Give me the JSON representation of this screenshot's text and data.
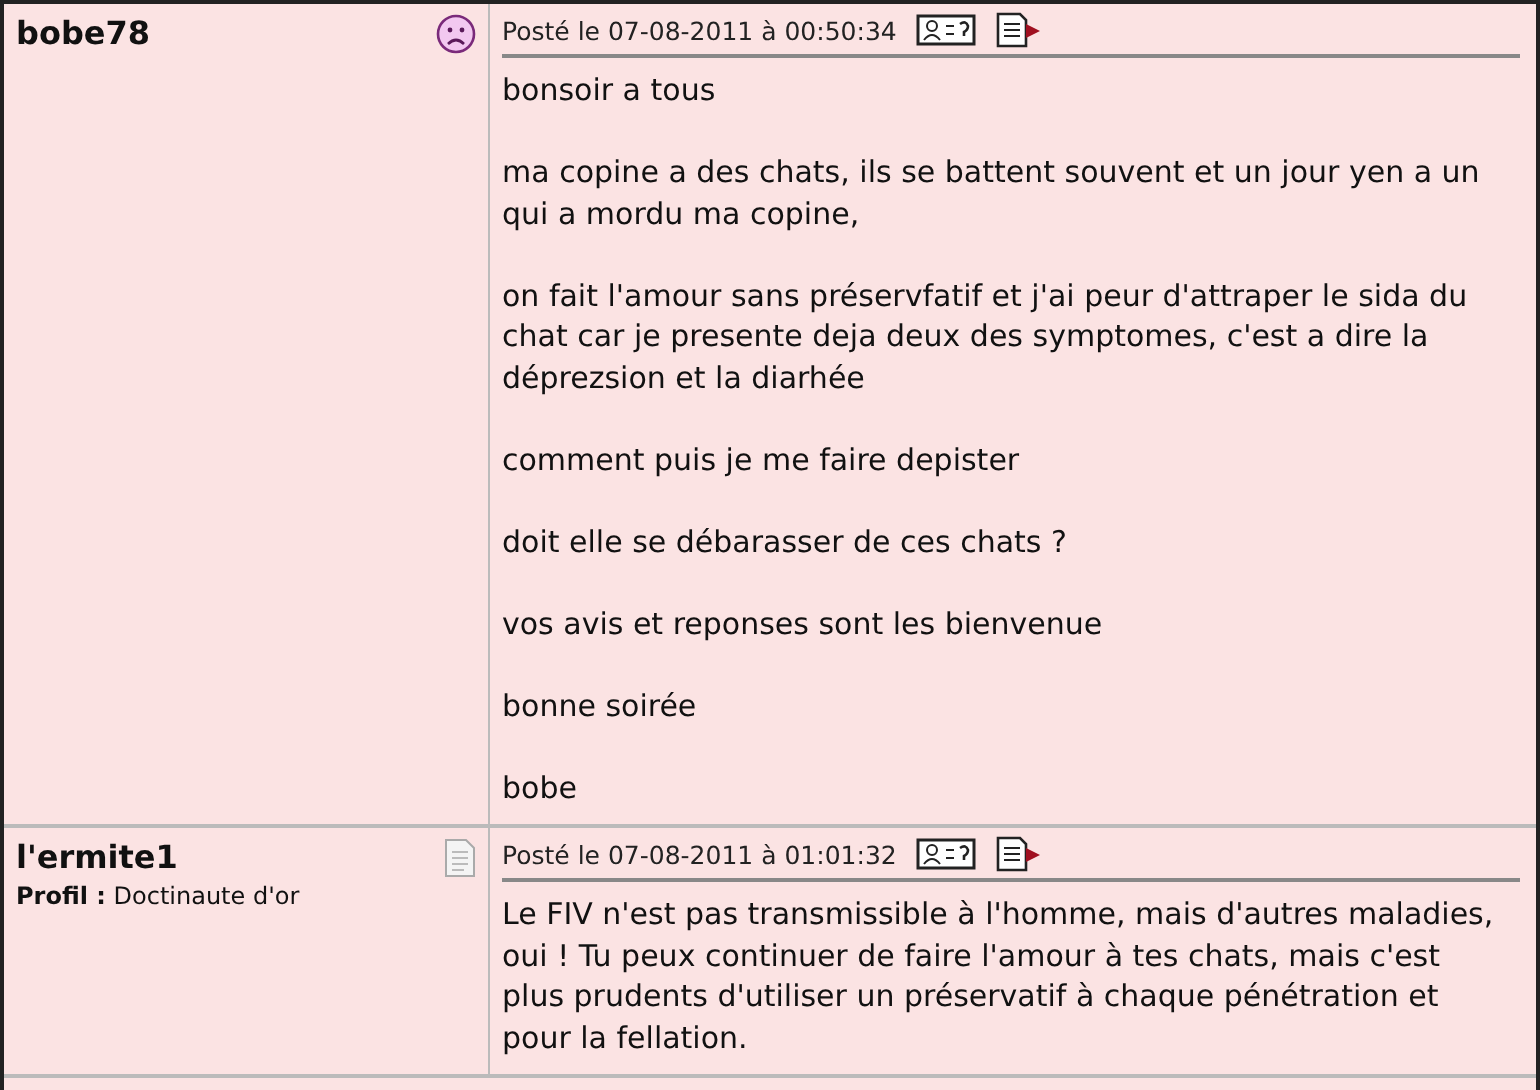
{
  "posts": [
    {
      "author": "bobe78",
      "kind": "sad",
      "date": "Posté le 07-08-2011 à 00:50:34",
      "paragraphs": [
        "bonsoir a tous",
        "ma copine a des chats, ils se battent souvent et un jour yen a un qui a mordu ma copine,",
        "on fait l'amour sans préservfatif et j'ai peur d'attraper le sida du chat car je presente deja deux des symptomes, c'est a dire la déprezsion et la diarhée",
        "comment puis je me faire depister",
        "doit elle se débarasser de ces chats ?",
        "vos avis et reponses sont les bienvenue",
        "bonne soirée",
        "bobe"
      ]
    },
    {
      "author": "l'ermite1",
      "profile": "**Profil :** Doctinaute d'or",
      "kind": "document",
      "date": "Posté le 07-08-2011 à 01:01:32",
      "paragraphs": [
        "Le FIV n'est pas transmissible à l'homme, mais d'autres maladies, oui ! Tu peux continuer de faire l'amour à tes chats, mais c'est plus prudents d'utiliser un préservatif à chaque pénétration et pour la fellation."
      ]
    }
  ]
}
